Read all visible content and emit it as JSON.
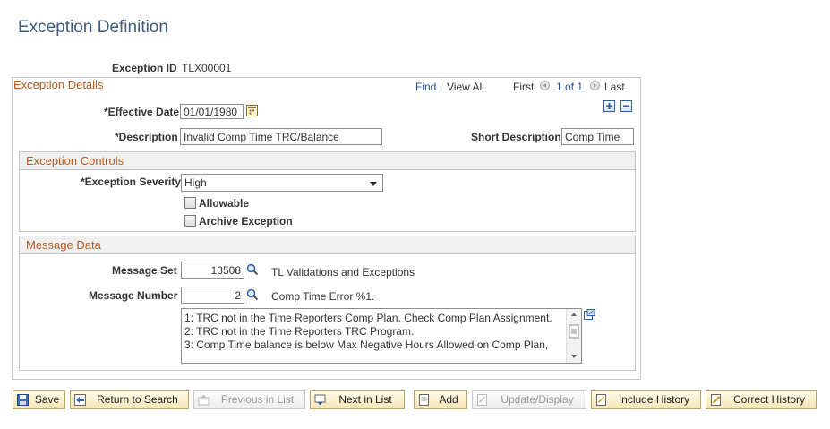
{
  "page": {
    "title": "Exception Definition"
  },
  "exception_id": {
    "label": "Exception ID",
    "value": "TLX00001"
  },
  "grid": {
    "title": "Exception Details",
    "find": "Find",
    "separator": "|",
    "view_all": "View All",
    "first": "First",
    "range": "1 of 1",
    "last": "Last"
  },
  "fields": {
    "effective_date": {
      "label": "*Effective Date",
      "value": "01/01/1980"
    },
    "description": {
      "label": "*Description",
      "value": "Invalid Comp Time TRC/Balance"
    },
    "short_description": {
      "label": "Short Description",
      "value": "Comp Time"
    }
  },
  "exception_controls": {
    "title": "Exception Controls",
    "severity_label": "*Exception Severity",
    "severity_value": "High",
    "allowable_label": "Allowable",
    "archive_label": "Archive Exception"
  },
  "message_data": {
    "title": "Message Data",
    "set_label": "Message Set",
    "set_value": "13508",
    "set_desc": "TL Validations and Exceptions",
    "number_label": "Message Number",
    "number_value": "2",
    "number_desc": "Comp Time Error %1.",
    "text": "1: TRC not in the Time Reporters Comp Plan.  Check Comp Plan Assignment.\n2: TRC not in the Time Reporters TRC Program.\n3: Comp Time balance is below Max Negative Hours Allowed on Comp Plan,"
  },
  "toolbar": {
    "save": "Save",
    "return_to_search": "Return to Search",
    "previous_in_list": "Previous in List",
    "next_in_list": "Next in List",
    "add": "Add",
    "update_display": "Update/Display",
    "include_history": "Include History",
    "correct_history": "Correct History"
  },
  "colors": {
    "title": "#3d5a80",
    "section": "#b55b1f",
    "link": "#1f4e9e",
    "button": "#f3e5b5"
  }
}
